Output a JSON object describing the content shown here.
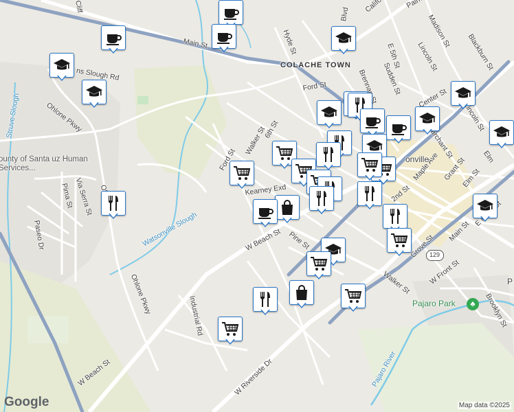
{
  "map": {
    "logo": "Google",
    "attribution": "Map data ©2025",
    "colors": {
      "land": "#eceae4",
      "residential": "#e4e2dc",
      "agriculture": "#e6ead3",
      "highway": "#8ea2c1",
      "road": "#ffffff",
      "water": "#7ecbe8",
      "park": "#c8e6c3",
      "downtown": "#f1eacd",
      "pin_border": "#2a77c9"
    },
    "labels": {
      "clifford": "Cliff",
      "main_st_west": "Main St",
      "hyde_st": "Hyde St",
      "california": "Californ",
      "palm": "Palm",
      "madison_st": "Madison St",
      "blackburn_st": "Blackburn St",
      "colache_town": "COLACHE TOWN",
      "lincoln_st": "Lincoln St",
      "e_5th_st": "E 5th St",
      "sudden_st": "Sudden St",
      "brennan_st": "Brennan St",
      "ford_st_north": "Ford St",
      "center_st": "Center St",
      "lincoln_st_2": "Lincoln St",
      "harvest_blvd": "Blvd",
      "slough_rd": "ns Slough Rd",
      "struve_slough": "Struve Slough",
      "ohlone_pkwy_upper": "Ohlone Pkwy",
      "marchant_st": "Marchant St",
      "elm": "Elm",
      "sixth_st": "6th St",
      "ford_st": "Ford St",
      "walker_st": "Walker St",
      "county_services": "ounty of Santa uz Human Services...",
      "maple_ave": "Maple Ave",
      "grant_st": "Grant St",
      "elm_st": "Elm St",
      "via_serra_st": "Via Serra St",
      "pima_st": "Pima St",
      "ohlone_pkwy_mid": "Ohl Pkwy",
      "kearney_st": "Kearney Exd",
      "watsonville_slough": "Watsonville Slough",
      "second_st": "2nd St",
      "paseo_dr": "Paseo Dr",
      "e_front_st": "E Front St",
      "w_beach_st_upper": "W Beach St",
      "pine_st": "Pine St",
      "main_st_east": "Main St",
      "grove_st": "Grove St",
      "w_front_st": "W Front St",
      "walker_st_south": "Walker St",
      "ohlone_pkwy_lower": "Ohlone Pkwy",
      "industrial_rd": "Industrial Rd",
      "pajaro_park": "Pajaro Park",
      "brooklyn_st": "Brooklyn St",
      "w_beach_st_lower": "W Beach St",
      "w_riverside_dr": "W Riverside Dr",
      "pajaro_river": "Pajaro River",
      "watsonville": "onville",
      "route_129": "129",
      "city_p": "P"
    },
    "pin_types": [
      "cafe-icon",
      "school-icon",
      "restaurant-icon",
      "grocery-cart-icon",
      "shopping-bag-icon"
    ]
  }
}
